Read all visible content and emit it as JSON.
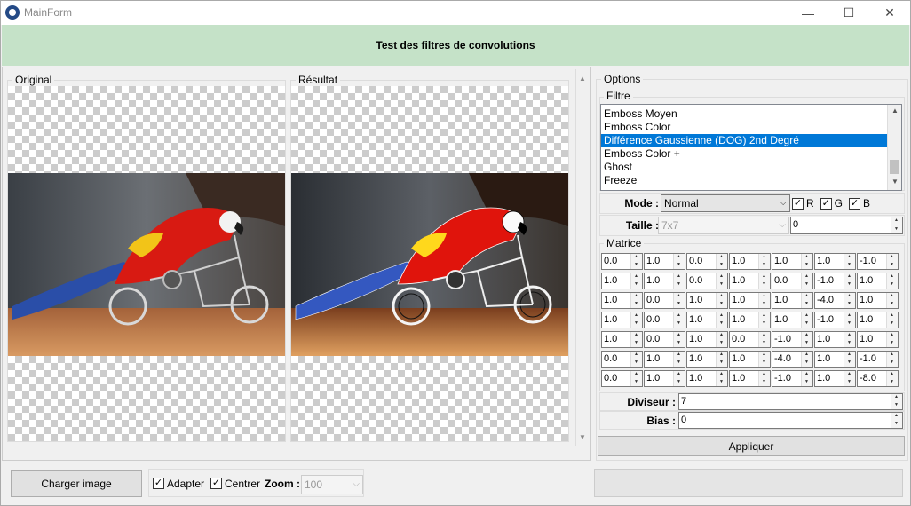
{
  "window": {
    "title": "MainForm",
    "minimize": "—",
    "maximize": "☐",
    "close": "✕"
  },
  "header": {
    "title": "Test des filtres de convolutions"
  },
  "panels": {
    "original_label": "Original",
    "result_label": "Résultat"
  },
  "options": {
    "group_label": "Options",
    "filter_label": "Filtre",
    "filters": [
      "Emboss Moyen",
      "Emboss Color",
      "Différence Gaussienne (DOG) 2nd Degré",
      "Emboss Color +",
      "Ghost",
      "Freeze"
    ],
    "selected_filter_index": 2,
    "mode_label": "Mode :",
    "mode_value": "Normal",
    "channels": [
      {
        "label": "R",
        "checked": true
      },
      {
        "label": "G",
        "checked": true
      },
      {
        "label": "B",
        "checked": true
      }
    ],
    "size_label": "Taille :",
    "size_value": "7x7",
    "size_spin_value": "0",
    "matrix_label": "Matrice",
    "matrix": [
      [
        "0.0",
        "1.0",
        "0.0",
        "1.0",
        "1.0",
        "1.0",
        "-1.0"
      ],
      [
        "1.0",
        "1.0",
        "0.0",
        "1.0",
        "0.0",
        "-1.0",
        "1.0"
      ],
      [
        "1.0",
        "0.0",
        "1.0",
        "1.0",
        "1.0",
        "-4.0",
        "1.0"
      ],
      [
        "1.0",
        "0.0",
        "1.0",
        "1.0",
        "1.0",
        "-1.0",
        "1.0"
      ],
      [
        "1.0",
        "0.0",
        "1.0",
        "0.0",
        "-1.0",
        "1.0",
        "1.0"
      ],
      [
        "0.0",
        "1.0",
        "1.0",
        "1.0",
        "-4.0",
        "1.0",
        "-1.0"
      ],
      [
        "0.0",
        "1.0",
        "1.0",
        "1.0",
        "-1.0",
        "1.0",
        "-8.0"
      ]
    ],
    "divisor_label": "Diviseur :",
    "divisor_value": "7",
    "bias_label": "Bias :",
    "bias_value": "0",
    "apply_label": "Appliquer"
  },
  "footer": {
    "load_label": "Charger image",
    "fit_label": "Adapter",
    "fit_checked": true,
    "center_label": "Centrer",
    "center_checked": true,
    "zoom_label": "Zoom :",
    "zoom_value": "100"
  }
}
